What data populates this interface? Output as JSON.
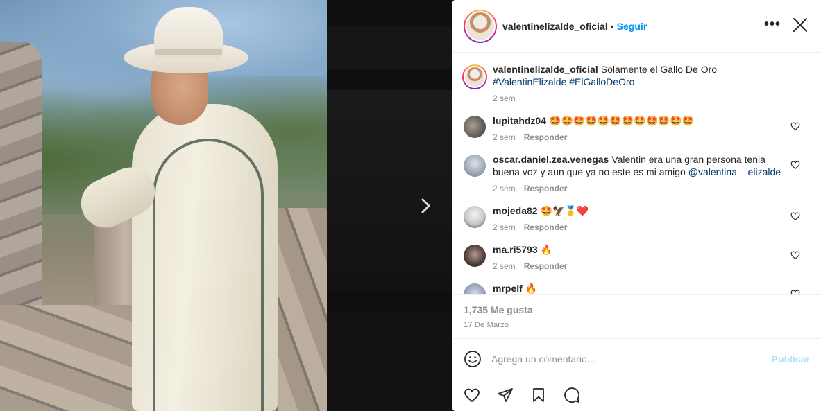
{
  "post": {
    "username": "valentinelizalde_oficial",
    "follow_label": "Seguir",
    "dot": "•",
    "more_label": "•••",
    "caption_text": "Solamente el Gallo De Oro",
    "caption_hashtags": "#ValentinElizalde #ElGalloDeOro",
    "caption_time": "2 sem",
    "likes": "1,735 Me gusta",
    "date": "17 De Marzo"
  },
  "comments": [
    {
      "user": "lupitahdz04",
      "text": "🤩🤩🤩🤩🤩🤩🤩🤩🤩🤩🤩🤩",
      "time": "2 sem",
      "reply": "Responder"
    },
    {
      "user": "oscar.daniel.zea.venegas",
      "text": "Valentin era una gran persona tenia buena voz y aun que ya no este es mi amigo",
      "mention": "@valentina__elizalde",
      "time": "2 sem",
      "reply": "Responder"
    },
    {
      "user": "mojeda82",
      "text": "🤩🦅🥇❤️",
      "time": "2 sem",
      "reply": "Responder"
    },
    {
      "user": "ma.ri5793",
      "text": "🔥",
      "time": "2 sem",
      "reply": "Responder"
    },
    {
      "user": "mrpelf",
      "text": "🔥",
      "time": "",
      "reply": ""
    }
  ],
  "comment_box": {
    "placeholder": "Agrega un comentario...",
    "publish_label": "Publicar"
  },
  "nav": {
    "next_arrow": "›"
  },
  "colors": {
    "link_blue": "#0095f6",
    "publish_disabled": "#b2dffc",
    "meta_gray": "#8e8e8e",
    "text_dark": "#262626"
  }
}
